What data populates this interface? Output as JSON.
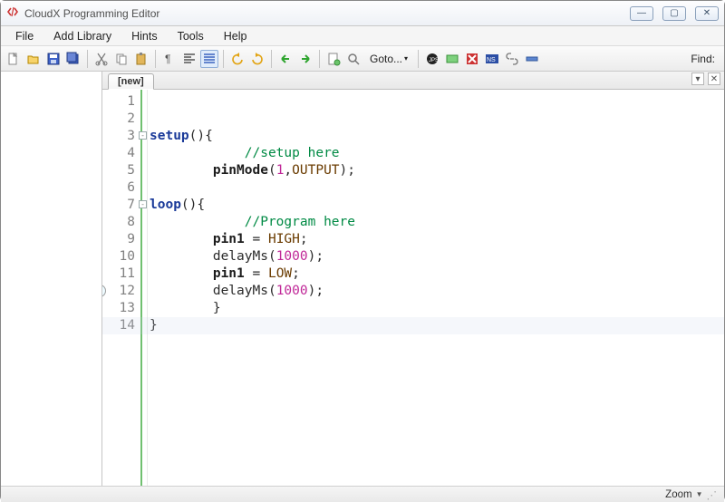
{
  "titlebar": {
    "title": "CloudX Programming Editor"
  },
  "menu": {
    "items": [
      "File",
      "Add Library",
      "Hints",
      "Tools",
      "Help"
    ]
  },
  "toolbar": {
    "goto_label": "Goto...",
    "find_label": "Find:"
  },
  "tabs": {
    "active": "[new]"
  },
  "editor": {
    "current_line": 14,
    "line_count": 14,
    "lines": [
      {
        "n": 1,
        "segments": []
      },
      {
        "n": 2,
        "segments": []
      },
      {
        "n": 3,
        "segments": [
          {
            "t": "setup",
            "c": "tok-kw"
          },
          {
            "t": "(){"
          }
        ],
        "fold": true
      },
      {
        "n": 4,
        "segments": [
          {
            "t": "            "
          },
          {
            "t": "//setup here",
            "c": "tok-comment"
          }
        ]
      },
      {
        "n": 5,
        "segments": [
          {
            "t": "        "
          },
          {
            "t": "pinMode",
            "c": "tok-fn"
          },
          {
            "t": "("
          },
          {
            "t": "1",
            "c": "tok-num"
          },
          {
            "t": ","
          },
          {
            "t": "OUTPUT",
            "c": "tok-const"
          },
          {
            "t": ");"
          }
        ]
      },
      {
        "n": 6,
        "segments": []
      },
      {
        "n": 7,
        "segments": [
          {
            "t": "loop",
            "c": "tok-kw"
          },
          {
            "t": "(){"
          }
        ],
        "fold": true
      },
      {
        "n": 8,
        "segments": [
          {
            "t": "            "
          },
          {
            "t": "//Program here",
            "c": "tok-comment"
          }
        ]
      },
      {
        "n": 9,
        "segments": [
          {
            "t": "        "
          },
          {
            "t": "pin1",
            "c": "tok-fn"
          },
          {
            "t": " = "
          },
          {
            "t": "HIGH",
            "c": "tok-const"
          },
          {
            "t": ";"
          }
        ]
      },
      {
        "n": 10,
        "segments": [
          {
            "t": "        delayMs("
          },
          {
            "t": "1000",
            "c": "tok-num"
          },
          {
            "t": ");"
          }
        ]
      },
      {
        "n": 11,
        "segments": [
          {
            "t": "        "
          },
          {
            "t": "pin1",
            "c": "tok-fn"
          },
          {
            "t": " = "
          },
          {
            "t": "LOW",
            "c": "tok-const"
          },
          {
            "t": ";"
          }
        ]
      },
      {
        "n": 12,
        "segments": [
          {
            "t": "        delayMs("
          },
          {
            "t": "1000",
            "c": "tok-num"
          },
          {
            "t": ");"
          }
        ],
        "marker": true
      },
      {
        "n": 13,
        "segments": [
          {
            "t": "        }"
          }
        ]
      },
      {
        "n": 14,
        "segments": [
          {
            "t": "}"
          }
        ]
      }
    ]
  },
  "statusbar": {
    "zoom_label": "Zoom"
  }
}
